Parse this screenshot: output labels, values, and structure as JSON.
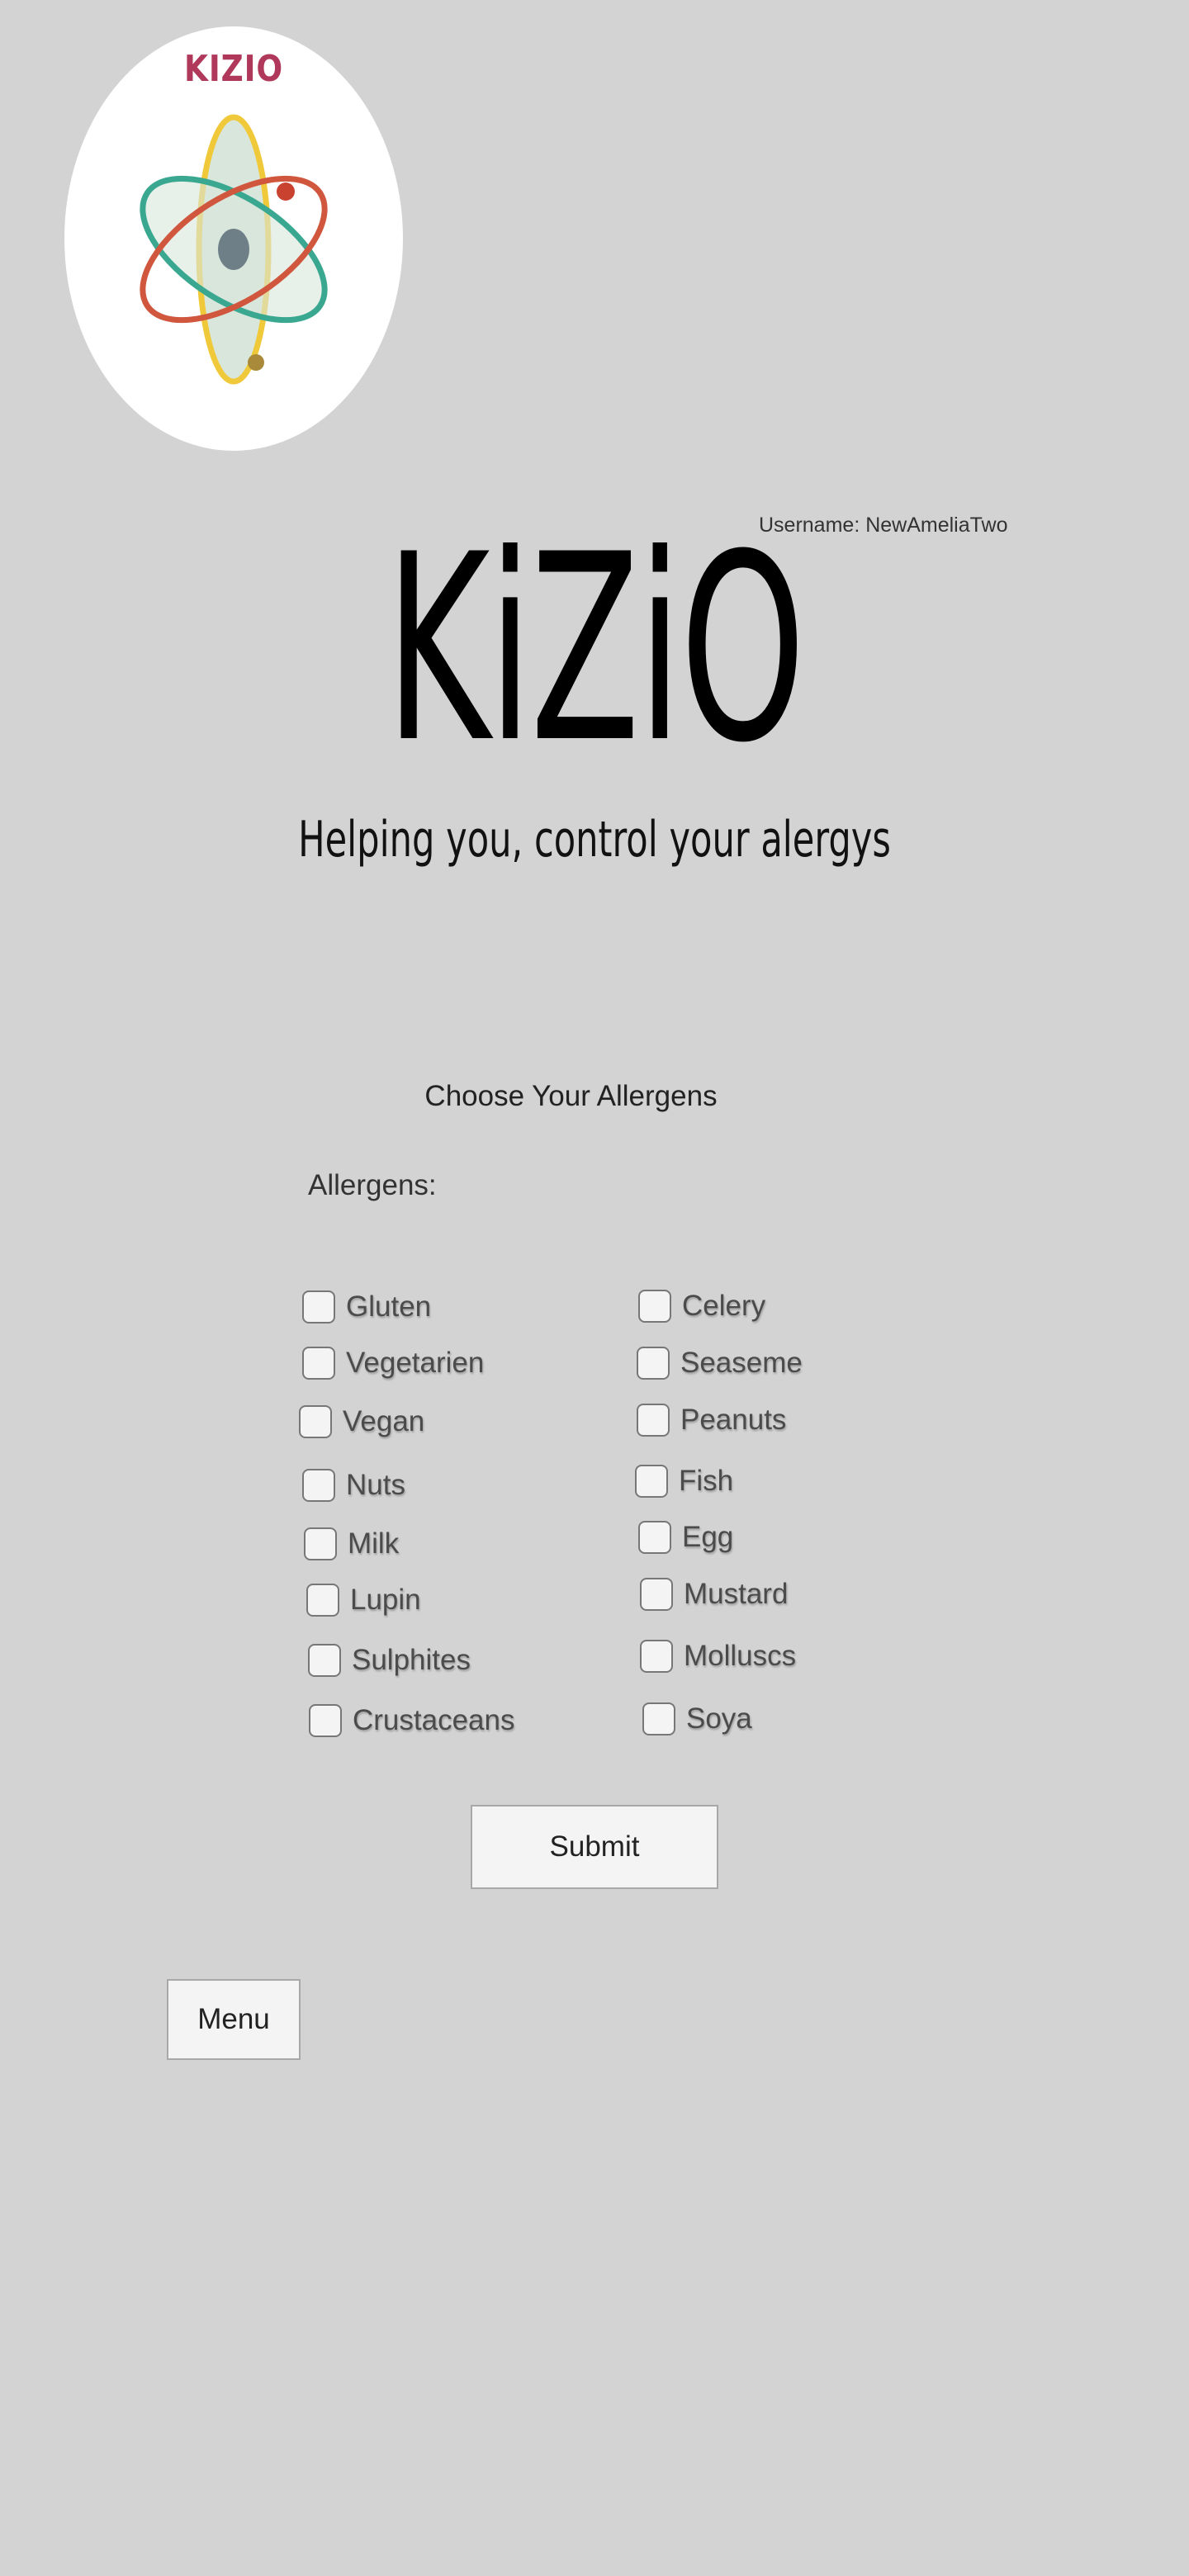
{
  "logo": {
    "text": "KIZIO",
    "icon": "atom-logo-icon",
    "colors": {
      "text": "#b0385a",
      "orbit_yellow": "#f0c93a",
      "orbit_teal": "#3aa890",
      "orbit_red": "#d0573e",
      "nucleus": "#6f7f87"
    }
  },
  "user": {
    "username_text": "Username: NewAmeliaTwo"
  },
  "brand": {
    "title": "KiZiO",
    "tagline": "Helping you, control your alergys"
  },
  "form": {
    "heading": "Choose Your Allergens",
    "label": "Allergens:",
    "left_column": [
      {
        "label": "Gluten",
        "checked": false
      },
      {
        "label": "Vegetarien",
        "checked": false
      },
      {
        "label": "Vegan",
        "checked": false
      },
      {
        "label": "Nuts",
        "checked": false
      },
      {
        "label": "Milk",
        "checked": false
      },
      {
        "label": "Lupin",
        "checked": false
      },
      {
        "label": "Sulphites",
        "checked": false
      },
      {
        "label": "Crustaceans",
        "checked": false
      }
    ],
    "right_column": [
      {
        "label": "Celery",
        "checked": false
      },
      {
        "label": "Seaseme",
        "checked": false
      },
      {
        "label": "Peanuts",
        "checked": false
      },
      {
        "label": "Fish",
        "checked": false
      },
      {
        "label": "Egg",
        "checked": false
      },
      {
        "label": "Mustard",
        "checked": false
      },
      {
        "label": "Molluscs",
        "checked": false
      },
      {
        "label": "Soya",
        "checked": false
      }
    ],
    "submit_label": "Submit"
  },
  "nav": {
    "menu_label": "Menu"
  },
  "colors": {
    "background": "#d3d3d3",
    "button_bg": "#f4f4f4"
  }
}
